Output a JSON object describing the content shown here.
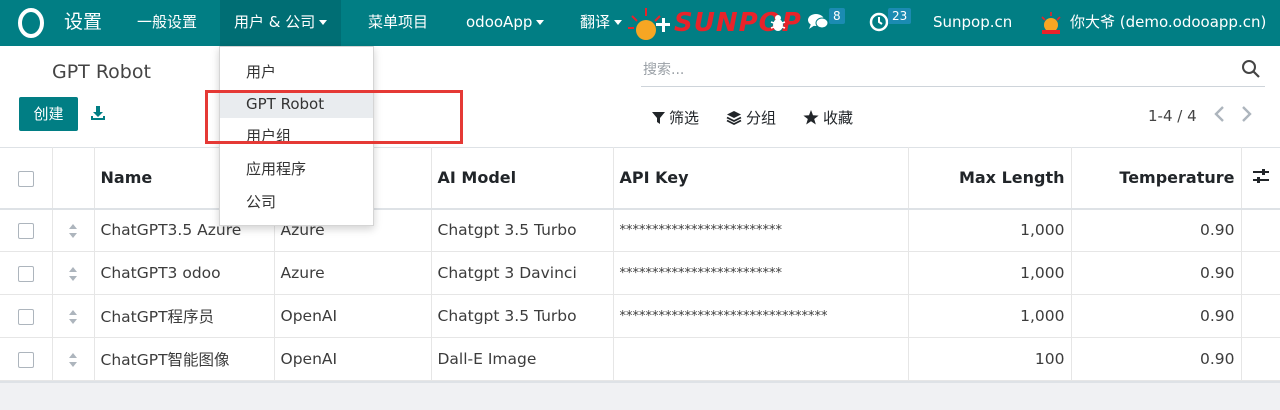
{
  "navbar": {
    "app_name": "设置",
    "menus": [
      {
        "label": "一般设置",
        "dropdown": false
      },
      {
        "label": "用户 & 公司",
        "dropdown": true,
        "active": true
      },
      {
        "label": "菜单项目",
        "dropdown": false
      },
      {
        "label": "odooApp",
        "dropdown": true
      },
      {
        "label": "翻译",
        "dropdown": true
      }
    ],
    "logo_text": "SUNPOP",
    "chat_count": "8",
    "activity_count": "23",
    "site_link": "Sunpop.cn",
    "user_name": "你大爷 (demo.odooapp.cn)",
    "colors": {
      "brand": "#017e84",
      "badge": "#1b8bb2",
      "highlight": "#e53935"
    }
  },
  "dropdown": {
    "items": [
      "用户",
      "GPT Robot",
      "用户组",
      "应用程序",
      "公司"
    ],
    "hover_index": 1
  },
  "control_panel": {
    "breadcrumb": "GPT Robot",
    "create_label": "创建",
    "search_placeholder": "搜索...",
    "filter_label": "筛选",
    "group_label": "分组",
    "favorite_label": "收藏",
    "pager": "1-4 / 4"
  },
  "table": {
    "columns": [
      "Name",
      "",
      "AI Model",
      "API Key",
      "Max Length",
      "Temperature"
    ],
    "rows": [
      {
        "name": "ChatGPT3.5 Azure",
        "provider": "Azure",
        "model": "Chatgpt 3.5 Turbo",
        "api_key": "*************************",
        "max_length": "1,000",
        "temperature": "0.90"
      },
      {
        "name": "ChatGPT3 odoo",
        "provider": "Azure",
        "model": "Chatgpt 3 Davinci",
        "api_key": "*************************",
        "max_length": "1,000",
        "temperature": "0.90"
      },
      {
        "name": "ChatGPT程序员",
        "provider": "OpenAI",
        "model": "Chatgpt 3.5 Turbo",
        "api_key": "********************************",
        "max_length": "1,000",
        "temperature": "0.90"
      },
      {
        "name": "ChatGPT智能图像",
        "provider": "OpenAI",
        "model": "Dall-E Image",
        "api_key": "",
        "max_length": "100",
        "temperature": "0.90"
      }
    ]
  }
}
